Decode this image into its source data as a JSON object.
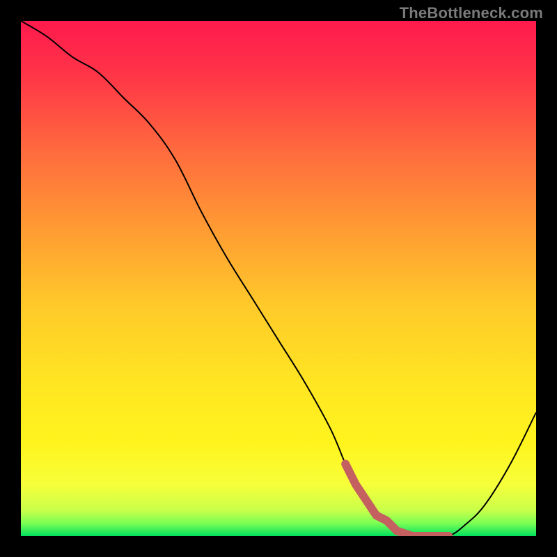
{
  "watermark": "TheBottleneck.com",
  "colors": {
    "gradient_stops": [
      {
        "offset": 0.0,
        "color": "#ff1a4d"
      },
      {
        "offset": 0.1,
        "color": "#ff3348"
      },
      {
        "offset": 0.25,
        "color": "#ff6a3e"
      },
      {
        "offset": 0.4,
        "color": "#ff9a33"
      },
      {
        "offset": 0.55,
        "color": "#ffc92a"
      },
      {
        "offset": 0.7,
        "color": "#ffe522"
      },
      {
        "offset": 0.82,
        "color": "#fff41e"
      },
      {
        "offset": 0.9,
        "color": "#f6ff3a"
      },
      {
        "offset": 0.95,
        "color": "#c9ff4a"
      },
      {
        "offset": 0.975,
        "color": "#7bff55"
      },
      {
        "offset": 1.0,
        "color": "#00e05e"
      }
    ],
    "curve": "#000000",
    "marker": "#c46060",
    "background": "#000000"
  },
  "chart_data": {
    "type": "line",
    "title": "",
    "xlabel": "",
    "ylabel": "",
    "xlim": [
      0,
      100
    ],
    "ylim": [
      0,
      100
    ],
    "series": [
      {
        "name": "bottleneck-curve",
        "x": [
          0,
          5,
          10,
          15,
          20,
          25,
          30,
          35,
          40,
          45,
          50,
          55,
          60,
          63,
          65,
          68,
          70,
          73,
          76,
          80,
          83,
          86,
          90,
          95,
          100
        ],
        "y": [
          100,
          97,
          93,
          90,
          85,
          80,
          73,
          63,
          54,
          46,
          38,
          30,
          21,
          14,
          10,
          5,
          3,
          1,
          0,
          0,
          0,
          2,
          6,
          14,
          24
        ]
      }
    ],
    "markers": {
      "name": "highlighted-segment",
      "x": [
        63,
        65,
        67,
        69,
        71,
        73,
        76,
        80,
        83
      ],
      "y": [
        14,
        10,
        7,
        4,
        3,
        1,
        0,
        0,
        0
      ]
    }
  }
}
